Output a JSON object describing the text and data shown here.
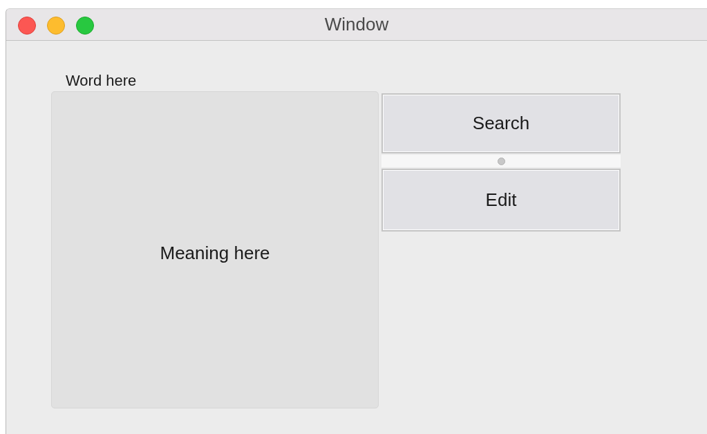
{
  "window": {
    "title": "Window"
  },
  "word_label": "Word here",
  "meaning_text": "Meaning here",
  "buttons": [
    "Search",
    "Edit"
  ]
}
